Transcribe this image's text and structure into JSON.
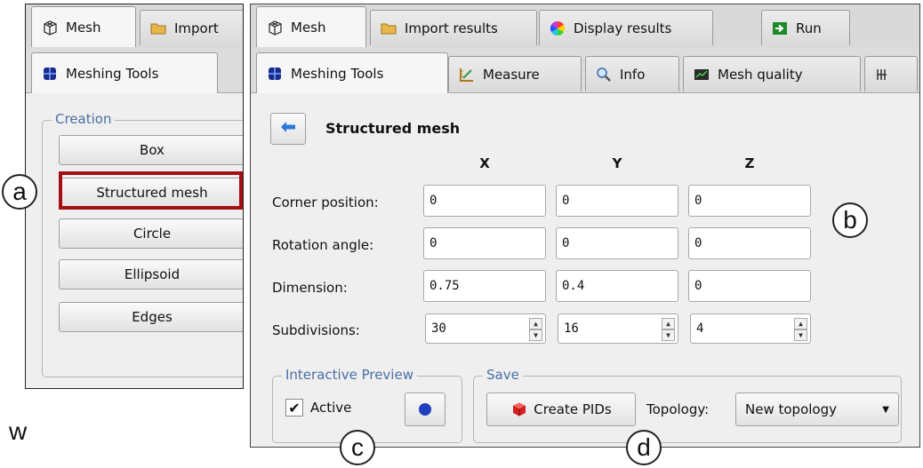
{
  "left_panel": {
    "tabs": [
      {
        "label": "Mesh",
        "icon": "mesh-cube-icon"
      },
      {
        "label": "Import",
        "icon": "folder-icon"
      }
    ],
    "subtab": {
      "label": "Meshing Tools",
      "icon": "meshing-tools-icon"
    },
    "creation_group": {
      "legend": "Creation",
      "buttons": [
        "Box",
        "Structured mesh",
        "Circle",
        "Ellipsoid",
        "Edges"
      ]
    }
  },
  "right_panel": {
    "tabs": [
      {
        "label": "Mesh",
        "icon": "mesh-cube-icon"
      },
      {
        "label": "Import results",
        "icon": "folder-icon"
      },
      {
        "label": "Display results",
        "icon": "color-wheel-icon"
      },
      {
        "label": "Run",
        "icon": "run-arrow-icon"
      }
    ],
    "subtabs": [
      {
        "label": "Meshing Tools",
        "icon": "meshing-tools-icon"
      },
      {
        "label": "Measure",
        "icon": "measure-icon"
      },
      {
        "label": "Info",
        "icon": "info-magnifier-icon"
      },
      {
        "label": "Mesh quality",
        "icon": "mesh-quality-icon"
      }
    ],
    "section_title": "Structured mesh",
    "columns": [
      "X",
      "Y",
      "Z"
    ],
    "rows": [
      {
        "label": "Corner position:",
        "values": [
          "0",
          "0",
          "0"
        ]
      },
      {
        "label": "Rotation angle:",
        "values": [
          "0",
          "0",
          "0"
        ]
      },
      {
        "label": "Dimension:",
        "values": [
          "0.75",
          "0.4",
          "0"
        ]
      },
      {
        "label": "Subdivisions:",
        "values": [
          "30",
          "16",
          "4"
        ]
      }
    ],
    "preview_group": {
      "legend": "Interactive Preview",
      "checkbox_label": "Active",
      "checked": true
    },
    "save_group": {
      "legend": "Save",
      "create_button": "Create PIDs",
      "topology_label": "Topology:",
      "topology_value": "New topology"
    }
  },
  "callouts": [
    "a",
    "b",
    "c",
    "d"
  ],
  "stray_text": "w",
  "colors": {
    "highlight": "#a30f12",
    "legend_text": "#4a6fa5",
    "pid_cube": "#d42020",
    "preview_dot": "#1f3fbf"
  }
}
